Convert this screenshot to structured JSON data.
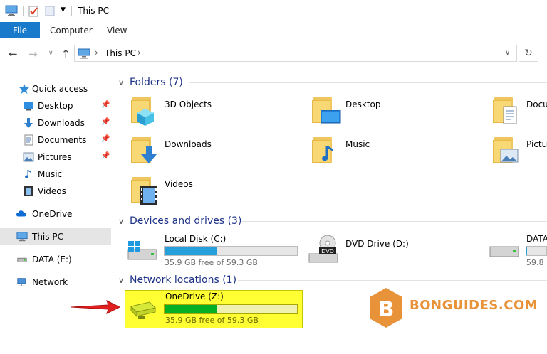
{
  "window": {
    "title": "This PC"
  },
  "ribbon": {
    "tabs": [
      "File",
      "Computer",
      "View"
    ]
  },
  "address": {
    "path": "This PC"
  },
  "sidebar": {
    "items": [
      {
        "label": "Quick access",
        "icon": "star-icon"
      },
      {
        "label": "Desktop",
        "icon": "desktop-icon",
        "pinned": true
      },
      {
        "label": "Downloads",
        "icon": "download-arrow-icon",
        "pinned": true
      },
      {
        "label": "Documents",
        "icon": "document-icon",
        "pinned": true
      },
      {
        "label": "Pictures",
        "icon": "picture-icon",
        "pinned": true
      },
      {
        "label": "Music",
        "icon": "music-note-icon"
      },
      {
        "label": "Videos",
        "icon": "film-icon"
      },
      {
        "label": "OneDrive",
        "icon": "cloud-icon"
      },
      {
        "label": "This PC",
        "icon": "computer-icon",
        "selected": true
      },
      {
        "label": "DATA (E:)",
        "icon": "drive-icon"
      },
      {
        "label": "Network",
        "icon": "network-icon"
      }
    ]
  },
  "groups": {
    "folders": {
      "title": "Folders (7)"
    },
    "devices": {
      "title": "Devices and drives (3)"
    },
    "network": {
      "title": "Network locations (1)"
    }
  },
  "folders": [
    {
      "label": "3D Objects"
    },
    {
      "label": "Desktop"
    },
    {
      "label": "Docu"
    },
    {
      "label": "Downloads"
    },
    {
      "label": "Music"
    },
    {
      "label": "Pictur"
    },
    {
      "label": "Videos"
    }
  ],
  "drives": [
    {
      "label": "Local Disk (C:)",
      "free": "35.9 GB free of 59.3 GB",
      "used_fraction": 0.39
    },
    {
      "label": "DVD Drive (D:)"
    },
    {
      "label": "DATA",
      "free": "59.8 (",
      "used_fraction": 0.02
    }
  ],
  "network_locations": [
    {
      "label": "OneDrive (Z:)",
      "free": "35.9 GB free of 59.3 GB",
      "used_fraction": 0.39
    }
  ],
  "watermark": {
    "text": "BONGUIDES.COM",
    "letter": "B"
  },
  "colors": {
    "file_tab": "#1979ca",
    "group_title": "#1e3287",
    "drive_fill_blue": "#26a0da",
    "drive_fill_green": "#06b025",
    "highlight": "#ffff33",
    "watermark": "#e8923a"
  }
}
